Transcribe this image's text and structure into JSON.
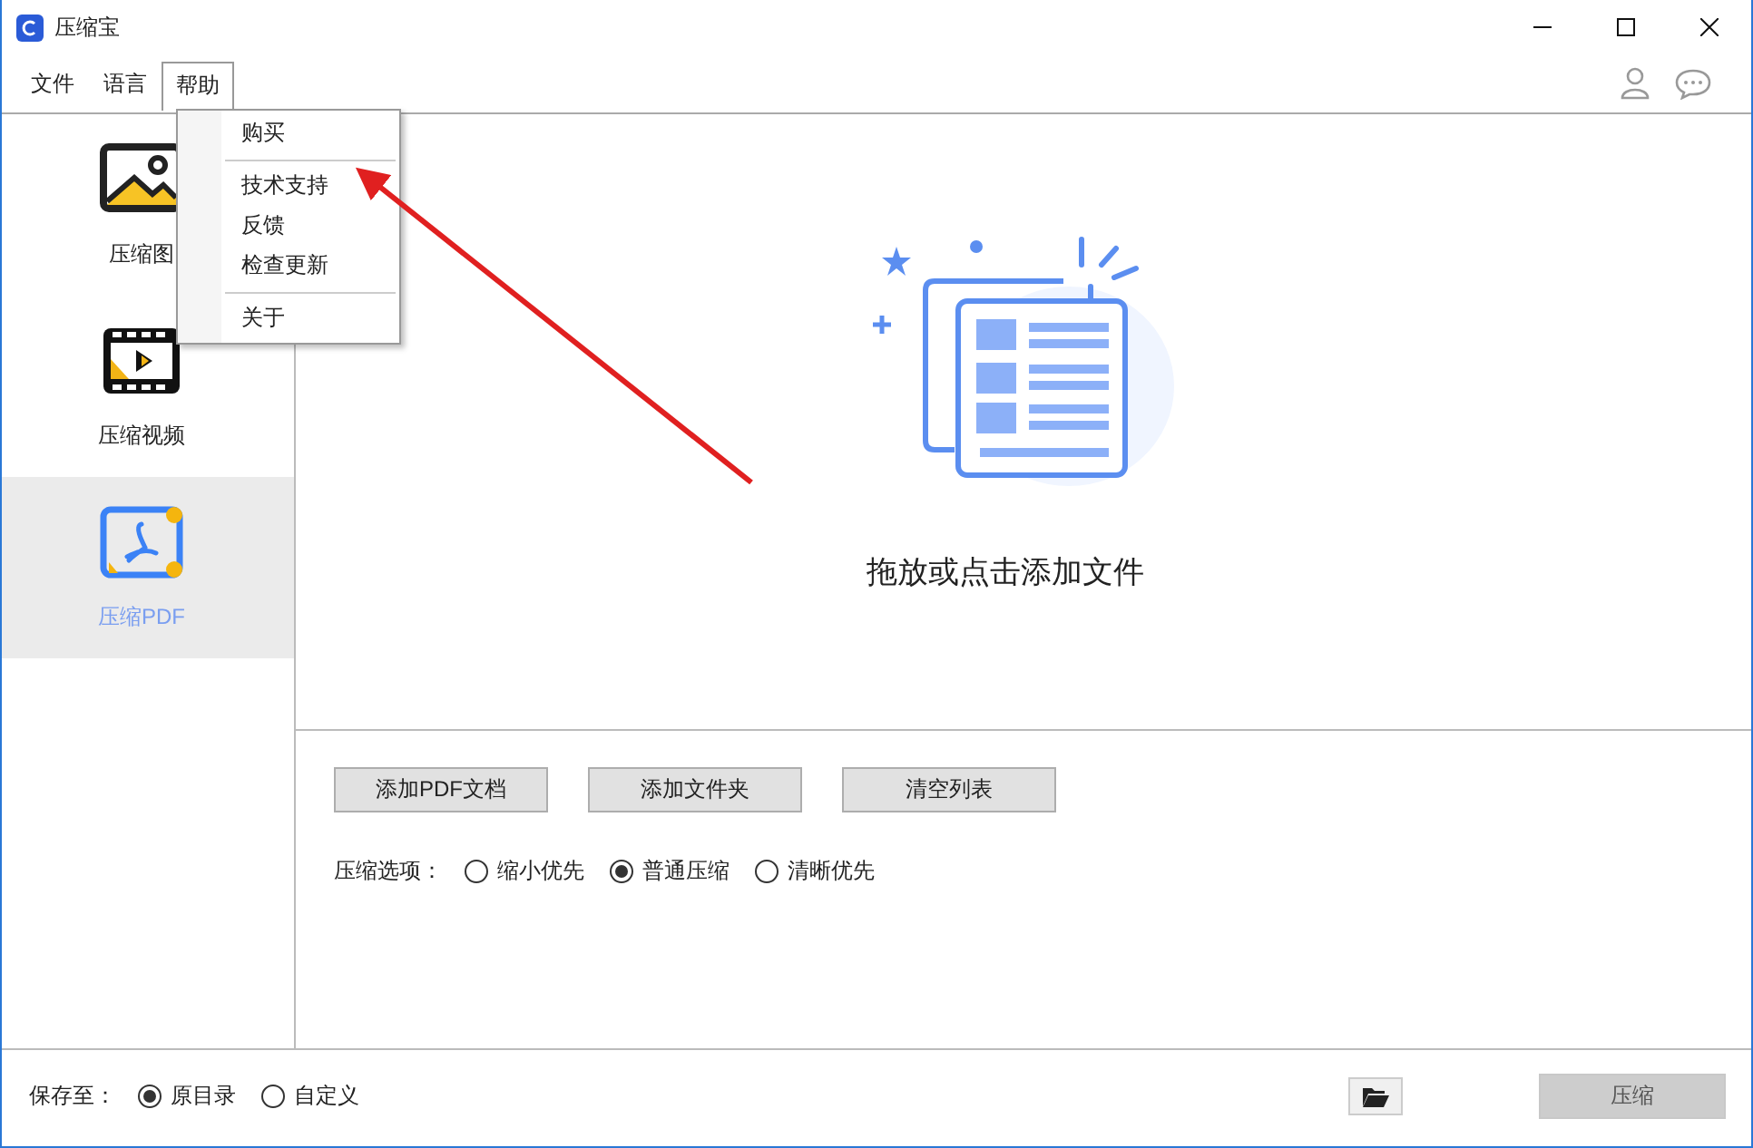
{
  "window": {
    "title": "压缩宝"
  },
  "menu_bar": [
    {
      "label": "文件",
      "open": false
    },
    {
      "label": "语言",
      "open": false
    },
    {
      "label": "帮助",
      "open": true
    }
  ],
  "help_menu": [
    {
      "kind": "item",
      "label": "购买"
    },
    {
      "kind": "separator"
    },
    {
      "kind": "item",
      "label": "技术支持"
    },
    {
      "kind": "item",
      "label": "反馈"
    },
    {
      "kind": "item",
      "label": "检查更新"
    },
    {
      "kind": "separator"
    },
    {
      "kind": "item",
      "label": "关于"
    }
  ],
  "sidebar": [
    {
      "kind": "image",
      "label": "压缩图",
      "selected": false
    },
    {
      "kind": "video",
      "label": "压缩视频",
      "selected": false
    },
    {
      "kind": "pdf",
      "label": "压缩PDF",
      "selected": true
    }
  ],
  "drop_zone": {
    "hint": "拖放或点击添加文件"
  },
  "buttons": [
    "添加PDF文档",
    "添加文件夹",
    "清空列表"
  ],
  "compress_options": {
    "label": "压缩选项：",
    "options": [
      {
        "label": "缩小优先",
        "selected": false
      },
      {
        "label": "普通压缩",
        "selected": true
      },
      {
        "label": "清晰优先",
        "selected": false
      }
    ]
  },
  "footer": {
    "label": "保存至：",
    "options": [
      {
        "label": "原目录",
        "selected": true
      },
      {
        "label": "自定义",
        "selected": false
      }
    ],
    "compress_button": {
      "label": "压缩",
      "disabled": true
    }
  }
}
